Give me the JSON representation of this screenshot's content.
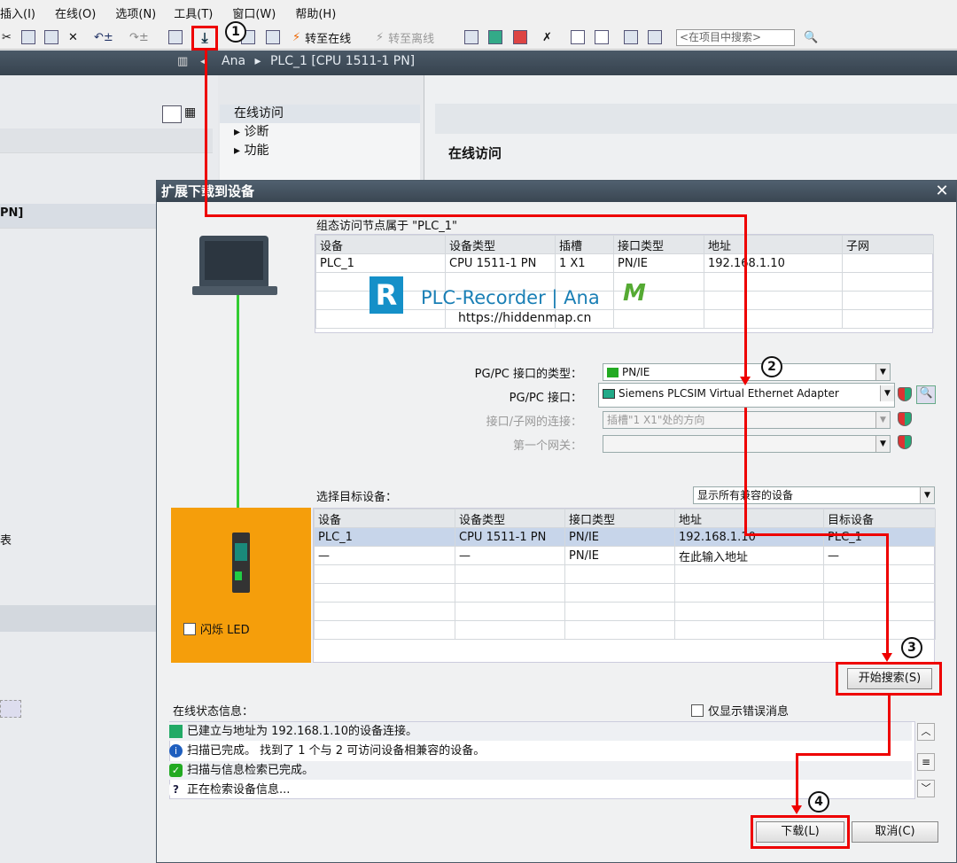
{
  "menu": [
    "插入(I)",
    "在线(O)",
    "选项(N)",
    "工具(T)",
    "窗口(W)",
    "帮助(H)"
  ],
  "toolbar": {
    "go_online": "转至在线",
    "go_offline": "转至离线",
    "search_placeholder": "<在项目中搜索>"
  },
  "breadcrumb": {
    "project": "Ana",
    "sep": "▸",
    "device": "PLC_1 [CPU 1511-1 PN]"
  },
  "left_pane": {
    "row_pn": "PN]",
    "row_table": "表"
  },
  "nav": {
    "items": [
      "在线访问",
      "▸ 诊断",
      "▸ 功能"
    ]
  },
  "right_panel": {
    "title": "在线访问"
  },
  "dialog": {
    "title": "扩展下载到设备",
    "config_caption": "组态访问节点属于 \"PLC_1\"",
    "config_table": {
      "headers": [
        "设备",
        "设备类型",
        "插槽",
        "接口类型",
        "地址",
        "子网"
      ],
      "rows": [
        [
          "PLC_1",
          "CPU 1511-1 PN",
          "1 X1",
          "PN/IE",
          "192.168.1.10",
          ""
        ]
      ]
    },
    "watermark": {
      "brand": "PLC-Recorder | Ana",
      "url": "https://hiddenmap.cn"
    },
    "pgpc_type_label": "PG/PC 接口的类型：",
    "pgpc_type_value": "PN/IE",
    "pgpc_if_label": "PG/PC 接口：",
    "pgpc_if_value": "Siemens PLCSIM Virtual Ethernet Adapter",
    "conn_label": "接口/子网的连接：",
    "conn_value": "插槽\"1 X1\"处的方向",
    "gateway_label": "第一个网关：",
    "gateway_value": "",
    "select_label": "选择目标设备：",
    "filter_value": "显示所有兼容的设备",
    "target_table": {
      "headers": [
        "设备",
        "设备类型",
        "接口类型",
        "地址",
        "目标设备"
      ],
      "rows": [
        [
          "PLC_1",
          "CPU 1511-1 PN",
          "PN/IE",
          "192.168.1.10",
          "PLC_1"
        ],
        [
          "—",
          "—",
          "PN/IE",
          "在此输入地址",
          "—"
        ]
      ]
    },
    "flash_led": "闪烁 LED",
    "start_search": "开始搜索(S)",
    "status_label": "在线状态信息：",
    "errors_only": "仅显示错误消息",
    "messages": [
      "已建立与地址为 192.168.1.10的设备连接。",
      "扫描已完成。 找到了 1 个与 2 可访问设备相兼容的设备。",
      "扫描与信息检索已完成。",
      "正在检索设备信息..."
    ],
    "download": "下载(L)",
    "cancel": "取消(C)"
  },
  "steps": [
    "1",
    "2",
    "3",
    "4"
  ],
  "colors": {
    "highlight": "#e00000",
    "orange": "#f59e0b",
    "titlebar": "#3a4652"
  }
}
